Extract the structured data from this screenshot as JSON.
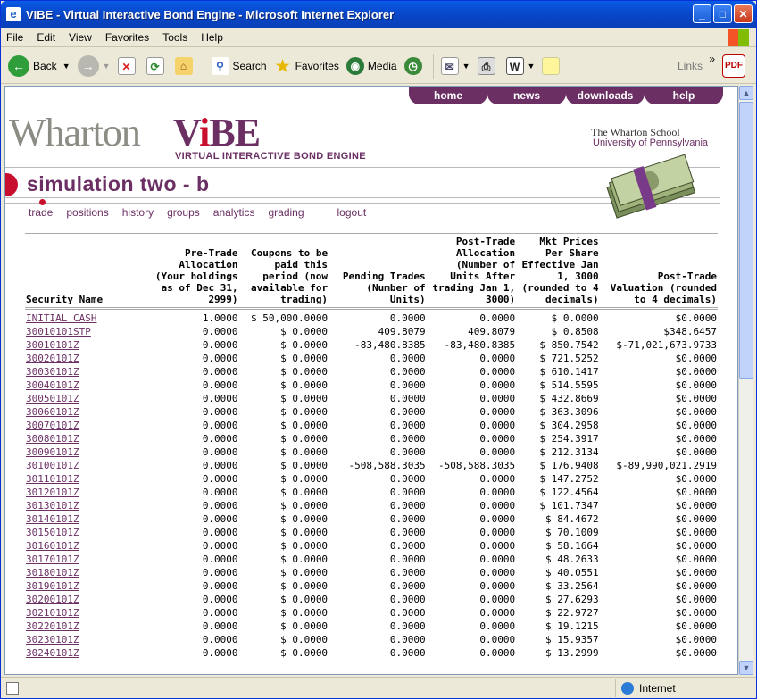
{
  "window": {
    "title": "VIBE - Virtual Interactive Bond Engine - Microsoft Internet Explorer",
    "icon_letter": "e"
  },
  "menu": [
    "File",
    "Edit",
    "View",
    "Favorites",
    "Tools",
    "Help"
  ],
  "toolbar": {
    "back": "Back",
    "search": "Search",
    "favorites": "Favorites",
    "media": "Media",
    "links": "Links"
  },
  "status": {
    "zone": "Internet"
  },
  "site": {
    "nav": [
      "home",
      "news",
      "downloads",
      "help"
    ],
    "brand_wharton": "Wharton",
    "brand_vibe_v": "V",
    "brand_vibe_i": "i",
    "brand_vibe_be": "BE",
    "brand_sub": "VIRTUAL INTERACTIVE BOND ENGINE",
    "school_line1": "The Wharton School",
    "school_line2": "University of Pennsylvania",
    "page_title": "simulation two - b",
    "subnav": [
      "trade",
      "positions",
      "history",
      "groups",
      "analytics",
      "grading"
    ],
    "logout": "logout"
  },
  "table": {
    "headers": [
      "Security Name",
      "Pre-Trade Allocation (Your holdings as of Dec 31, 2999)",
      "Coupons to be paid this period (now available for trading)",
      "Pending Trades (Number of Units)",
      "Post-Trade Allocation (Number of Units After trading Jan 1, 3000)",
      "Mkt Prices Per Share Effective Jan 1, 3000 (rounded to 4 decimals)",
      "Post-Trade Valuation (rounded to 4 decimals)"
    ],
    "rows": [
      [
        "INITIAL CASH",
        "1.0000",
        "$ 50,000.0000",
        "0.0000",
        "0.0000",
        "$ 0.0000",
        "$0.0000"
      ],
      [
        "30010101STP",
        "0.0000",
        "$ 0.0000",
        "409.8079",
        "409.8079",
        "$ 0.8508",
        "$348.6457"
      ],
      [
        "30010101Z",
        "0.0000",
        "$ 0.0000",
        "-83,480.8385",
        "-83,480.8385",
        "$ 850.7542",
        "$-71,021,673.9733"
      ],
      [
        "30020101Z",
        "0.0000",
        "$ 0.0000",
        "0.0000",
        "0.0000",
        "$ 721.5252",
        "$0.0000"
      ],
      [
        "30030101Z",
        "0.0000",
        "$ 0.0000",
        "0.0000",
        "0.0000",
        "$ 610.1417",
        "$0.0000"
      ],
      [
        "30040101Z",
        "0.0000",
        "$ 0.0000",
        "0.0000",
        "0.0000",
        "$ 514.5595",
        "$0.0000"
      ],
      [
        "30050101Z",
        "0.0000",
        "$ 0.0000",
        "0.0000",
        "0.0000",
        "$ 432.8669",
        "$0.0000"
      ],
      [
        "30060101Z",
        "0.0000",
        "$ 0.0000",
        "0.0000",
        "0.0000",
        "$ 363.3096",
        "$0.0000"
      ],
      [
        "30070101Z",
        "0.0000",
        "$ 0.0000",
        "0.0000",
        "0.0000",
        "$ 304.2958",
        "$0.0000"
      ],
      [
        "30080101Z",
        "0.0000",
        "$ 0.0000",
        "0.0000",
        "0.0000",
        "$ 254.3917",
        "$0.0000"
      ],
      [
        "30090101Z",
        "0.0000",
        "$ 0.0000",
        "0.0000",
        "0.0000",
        "$ 212.3134",
        "$0.0000"
      ],
      [
        "30100101Z",
        "0.0000",
        "$ 0.0000",
        "-508,588.3035",
        "-508,588.3035",
        "$ 176.9408",
        "$-89,990,021.2919"
      ],
      [
        "30110101Z",
        "0.0000",
        "$ 0.0000",
        "0.0000",
        "0.0000",
        "$ 147.2752",
        "$0.0000"
      ],
      [
        "30120101Z",
        "0.0000",
        "$ 0.0000",
        "0.0000",
        "0.0000",
        "$ 122.4564",
        "$0.0000"
      ],
      [
        "30130101Z",
        "0.0000",
        "$ 0.0000",
        "0.0000",
        "0.0000",
        "$ 101.7347",
        "$0.0000"
      ],
      [
        "30140101Z",
        "0.0000",
        "$ 0.0000",
        "0.0000",
        "0.0000",
        "$ 84.4672",
        "$0.0000"
      ],
      [
        "30150101Z",
        "0.0000",
        "$ 0.0000",
        "0.0000",
        "0.0000",
        "$ 70.1009",
        "$0.0000"
      ],
      [
        "30160101Z",
        "0.0000",
        "$ 0.0000",
        "0.0000",
        "0.0000",
        "$ 58.1664",
        "$0.0000"
      ],
      [
        "30170101Z",
        "0.0000",
        "$ 0.0000",
        "0.0000",
        "0.0000",
        "$ 48.2633",
        "$0.0000"
      ],
      [
        "30180101Z",
        "0.0000",
        "$ 0.0000",
        "0.0000",
        "0.0000",
        "$ 40.0551",
        "$0.0000"
      ],
      [
        "30190101Z",
        "0.0000",
        "$ 0.0000",
        "0.0000",
        "0.0000",
        "$ 33.2564",
        "$0.0000"
      ],
      [
        "30200101Z",
        "0.0000",
        "$ 0.0000",
        "0.0000",
        "0.0000",
        "$ 27.6293",
        "$0.0000"
      ],
      [
        "30210101Z",
        "0.0000",
        "$ 0.0000",
        "0.0000",
        "0.0000",
        "$ 22.9727",
        "$0.0000"
      ],
      [
        "30220101Z",
        "0.0000",
        "$ 0.0000",
        "0.0000",
        "0.0000",
        "$ 19.1215",
        "$0.0000"
      ],
      [
        "30230101Z",
        "0.0000",
        "$ 0.0000",
        "0.0000",
        "0.0000",
        "$ 15.9357",
        "$0.0000"
      ],
      [
        "30240101Z",
        "0.0000",
        "$ 0.0000",
        "0.0000",
        "0.0000",
        "$ 13.2999",
        "$0.0000"
      ]
    ]
  }
}
